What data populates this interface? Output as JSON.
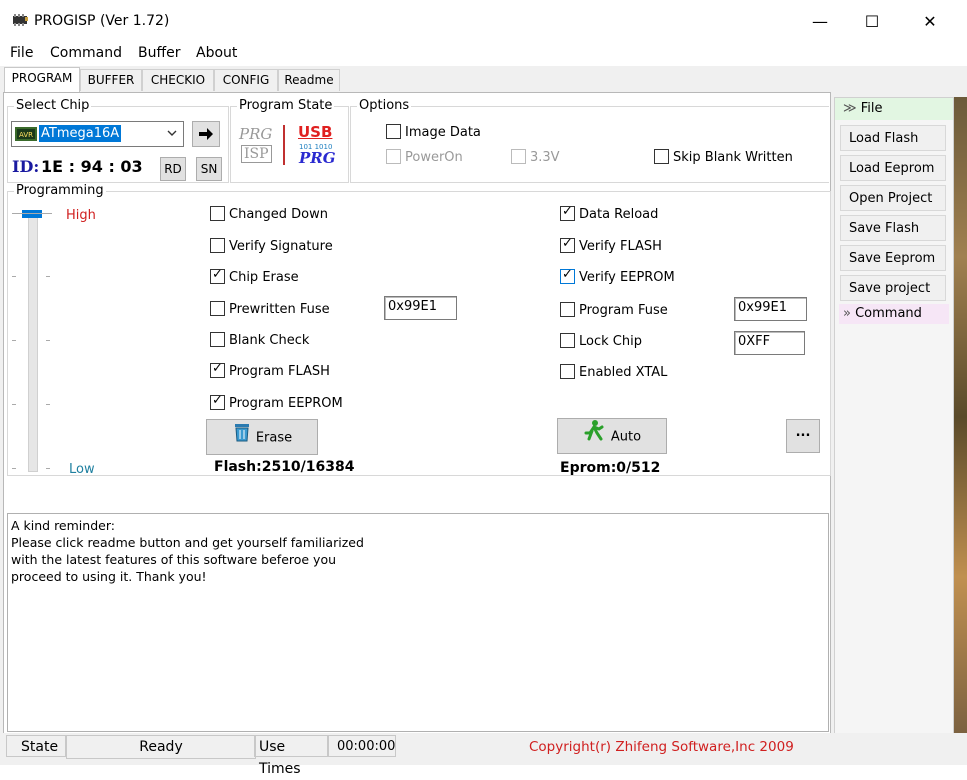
{
  "window": {
    "title": "PROGISP (Ver 1.72)",
    "minimize": "—",
    "maximize": "☐",
    "close": "✕"
  },
  "menu": [
    "File",
    "Command",
    "Buffer",
    "About"
  ],
  "tabs": [
    "PROGRAM",
    "BUFFER",
    "CHECKIO",
    "CONFIG",
    "Readme"
  ],
  "select_chip": {
    "label": "Select Chip",
    "chip": "ATmega16A",
    "id_label": "ID:",
    "id_value": "1E : 94 : 03",
    "rd": "RD",
    "sn": "SN"
  },
  "program_state": {
    "label": "Program State",
    "prg_isp_top": "PRG",
    "prg_isp_bottom": "ISP",
    "usb_top": "USB",
    "usb_bottom": "PRG"
  },
  "options": {
    "label": "Options",
    "image_data": "Image Data",
    "power_on": "PowerOn",
    "v33": "3.3V",
    "skip_blank": "Skip Blank Written"
  },
  "programming": {
    "label": "Programming",
    "high": "High",
    "low": "Low",
    "left_checks": [
      {
        "label": "Changed Down",
        "checked": false
      },
      {
        "label": "Verify Signature",
        "checked": false
      },
      {
        "label": "Chip Erase",
        "checked": true
      },
      {
        "label": "Prewritten Fuse",
        "checked": false
      },
      {
        "label": "Blank Check",
        "checked": false
      },
      {
        "label": "Program FLASH",
        "checked": true
      },
      {
        "label": "Program EEPROM",
        "checked": true
      }
    ],
    "right_checks": [
      {
        "label": "Data Reload",
        "checked": true
      },
      {
        "label": "Verify FLASH",
        "checked": true
      },
      {
        "label": "Verify EEPROM",
        "checked": true
      },
      {
        "label": "Program Fuse",
        "checked": false
      },
      {
        "label": "Lock Chip",
        "checked": false
      },
      {
        "label": "Enabled XTAL",
        "checked": false
      }
    ],
    "prewritten_fuse_value": "0x99E1",
    "program_fuse_value": "0x99E1",
    "lock_value": "0XFF",
    "erase_button": "Erase",
    "auto_button": "Auto",
    "more_button": "...",
    "flash_info": "Flash:2510/16384",
    "eprom_info": "Eprom:0/512"
  },
  "reminder": [
    "A kind reminder:",
    "Please click readme button and get yourself familiarized",
    "with the latest features of this software beferoe you",
    "proceed to using it. Thank you!"
  ],
  "sidebar": {
    "file_header": "File",
    "buttons": [
      "Load Flash",
      "Load Eeprom",
      "Open Project",
      "Save Flash",
      "Save Eeprom",
      "Save project"
    ],
    "command_header": "Command"
  },
  "status": {
    "state_label": "State",
    "state_value": "Ready",
    "use_times_label": "Use Times",
    "use_times_value": "00:00:00",
    "copyright": "Copyright(r) Zhifeng Software,Inc 2009"
  },
  "colors": {
    "high": "#d02020",
    "low": "#2080a0",
    "usb": "#e02020",
    "copyright": "#d02020",
    "chip_highlight": "#0078d7"
  }
}
